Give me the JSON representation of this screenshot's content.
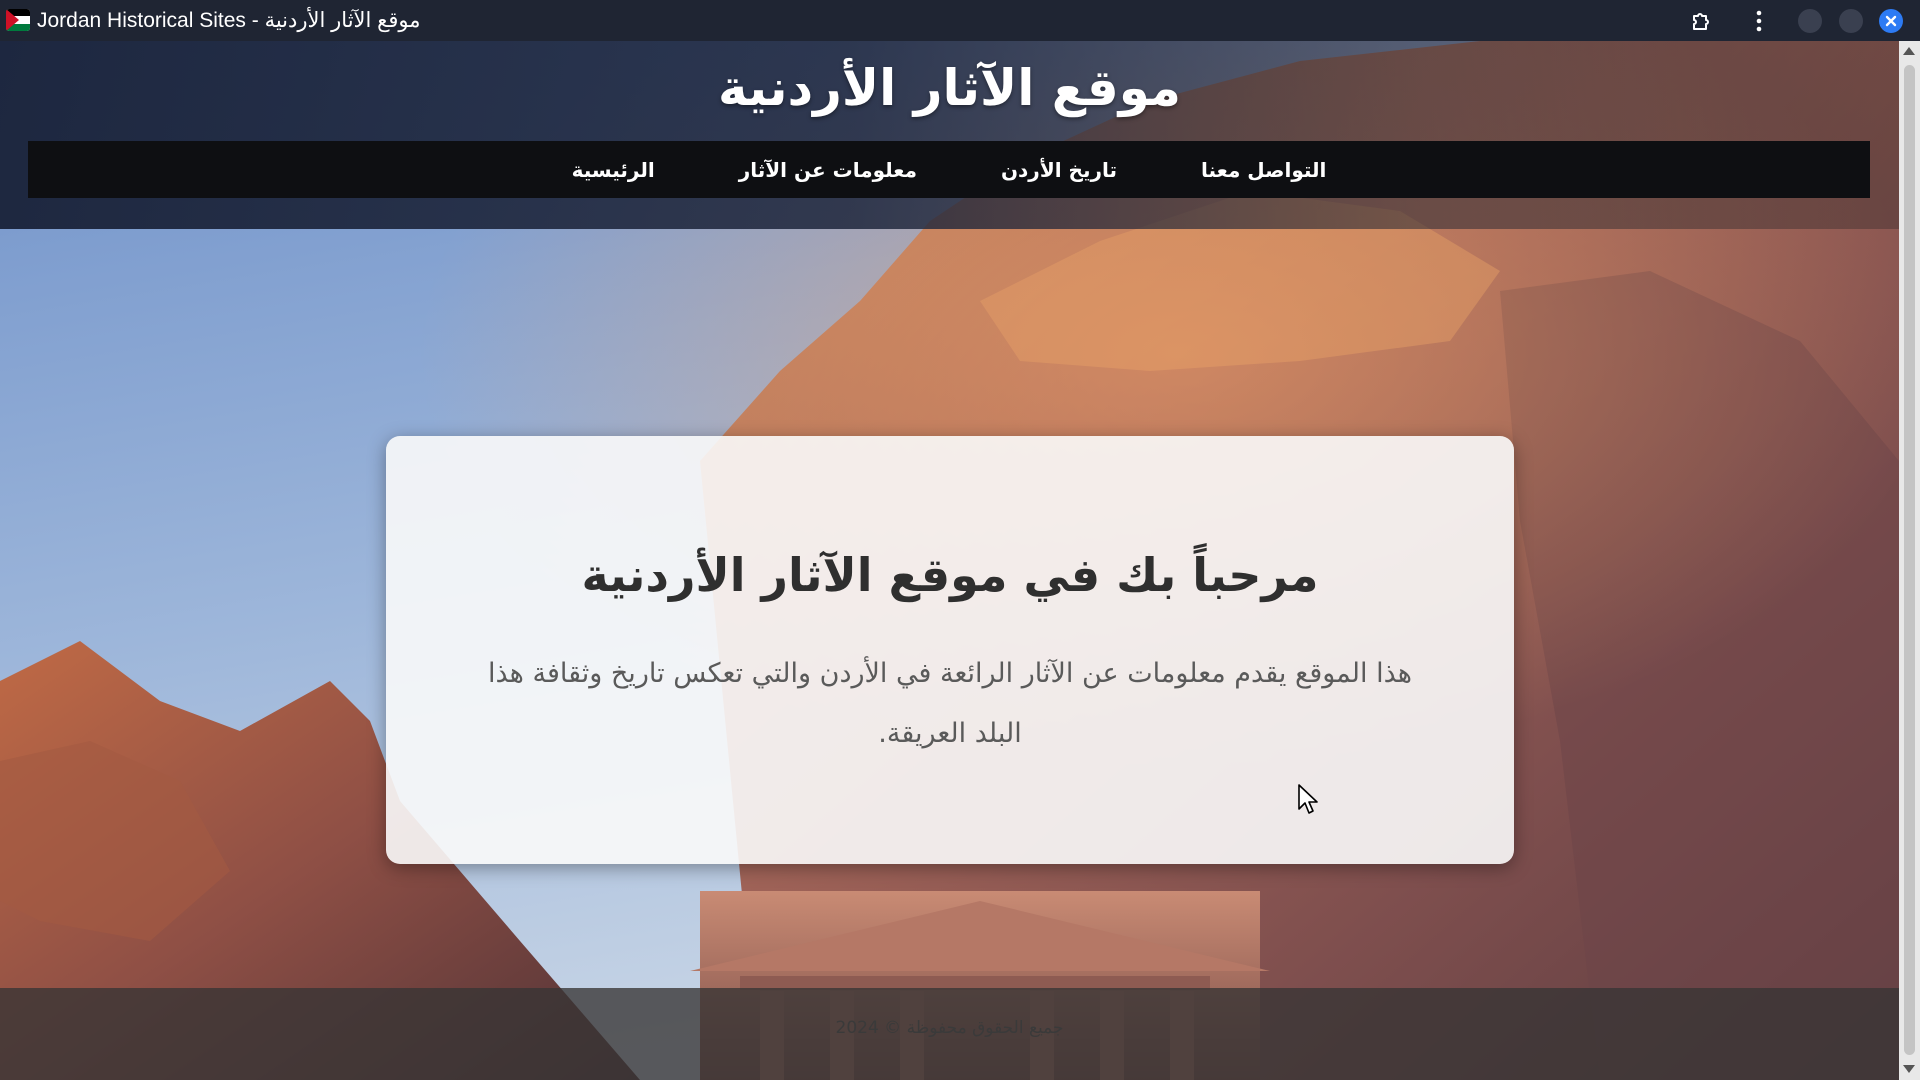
{
  "window": {
    "title": "Jordan Historical Sites - موقع الآثار الأردنية"
  },
  "site": {
    "title": "موقع الآثار الأردنية",
    "nav": [
      {
        "label": "التواصل معنا"
      },
      {
        "label": "تاريخ الأردن"
      },
      {
        "label": "معلومات عن الآثار"
      },
      {
        "label": "الرئيسية"
      }
    ]
  },
  "welcome": {
    "heading": "مرحباً بك في موقع الآثار الأردنية",
    "text": "هذا الموقع يقدم معلومات عن الآثار الرائعة في الأردن والتي تعكس تاريخ وثقافة هذا البلد العريقة."
  },
  "footer": {
    "text": "جميع الحقوق محفوظة © 2024"
  },
  "icons": {
    "favicon": "jordan-flag-icon",
    "extensions": "puzzle-icon",
    "menu": "kebab-menu-icon",
    "minimize": "circle-icon",
    "maximize": "circle-icon",
    "close": "close-icon",
    "cursor": "mouse-pointer-icon"
  },
  "colors": {
    "titlebar": "#1f2533",
    "nav_bg": "#0e0f12",
    "close_button": "#2d7bf4"
  }
}
